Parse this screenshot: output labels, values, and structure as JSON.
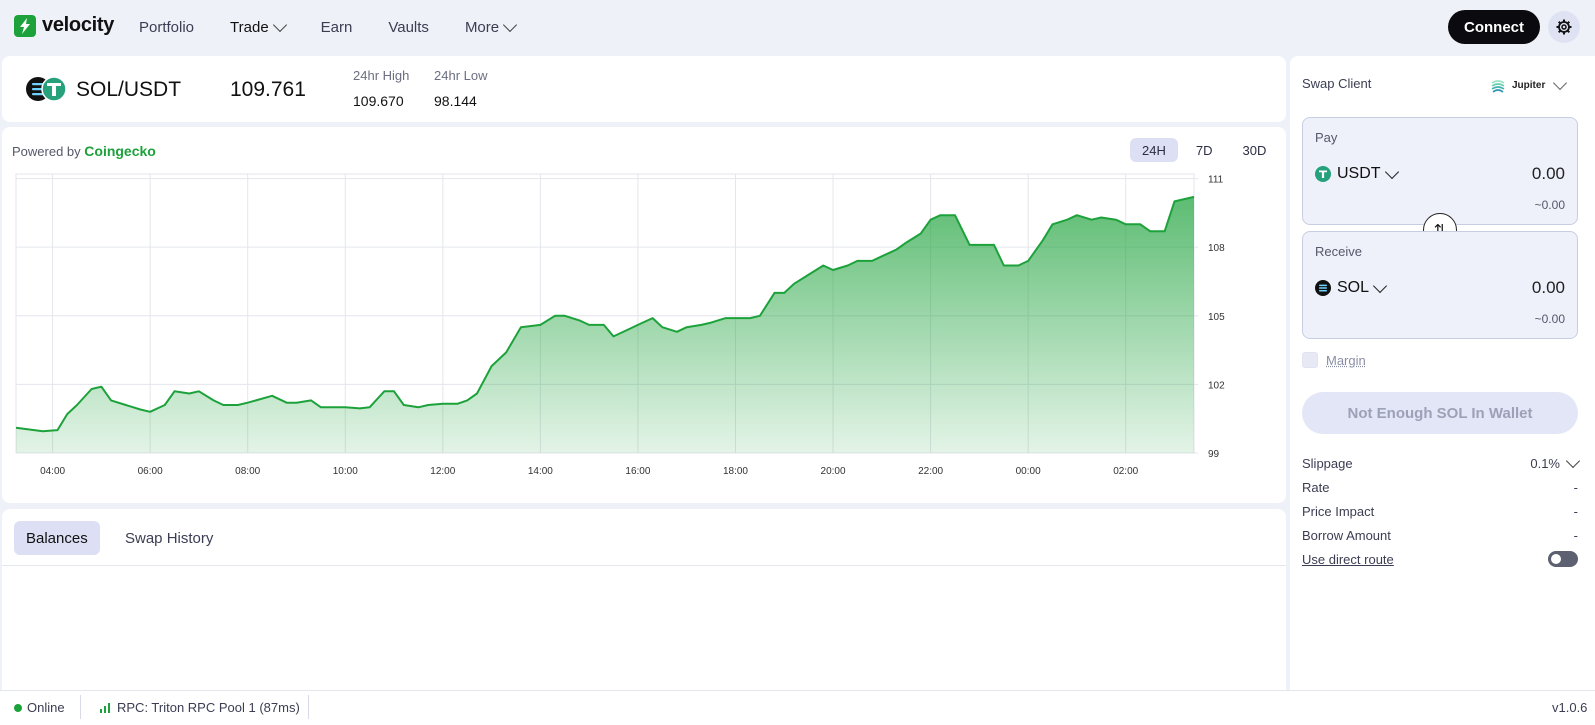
{
  "nav": {
    "brand": "velocity",
    "items": [
      {
        "label": "Portfolio",
        "dropdown": false
      },
      {
        "label": "Trade",
        "dropdown": true
      },
      {
        "label": "Earn",
        "dropdown": false
      },
      {
        "label": "Vaults",
        "dropdown": false
      },
      {
        "label": "More",
        "dropdown": true
      }
    ],
    "connect_label": "Connect"
  },
  "pair": {
    "name": "SOL/USDT",
    "price": "109.761",
    "high_label": "24hr High",
    "high_value": "109.670",
    "low_label": "24hr Low",
    "low_value": "98.144"
  },
  "chart_header": {
    "powered_prefix": "Powered by",
    "powered_brand": "Coingecko",
    "ranges": [
      "24H",
      "7D",
      "30D"
    ],
    "active_range": "24H"
  },
  "chart_data": {
    "type": "area",
    "x_ticks": [
      "04:00",
      "06:00",
      "08:00",
      "10:00",
      "12:00",
      "14:00",
      "16:00",
      "18:00",
      "20:00",
      "22:00",
      "00:00",
      "02:00"
    ],
    "y_ticks": [
      111,
      108,
      105,
      102,
      99
    ],
    "ylim": [
      99,
      111.2
    ],
    "xlim": [
      3.25,
      27.4
    ],
    "grid": true,
    "color": "#1da23b",
    "x": [
      3.25,
      3.8,
      4.1,
      4.3,
      4.5,
      4.8,
      5.0,
      5.2,
      5.5,
      5.8,
      6.0,
      6.3,
      6.5,
      6.8,
      7.0,
      7.3,
      7.5,
      7.8,
      8.0,
      8.5,
      8.8,
      9.0,
      9.3,
      9.5,
      9.8,
      10.0,
      10.3,
      10.5,
      10.8,
      11.0,
      11.2,
      11.5,
      11.7,
      12.0,
      12.3,
      12.5,
      12.7,
      13.0,
      13.3,
      13.6,
      14.0,
      14.3,
      14.5,
      14.8,
      15.0,
      15.3,
      15.5,
      15.8,
      16.0,
      16.3,
      16.5,
      16.8,
      17.0,
      17.3,
      17.5,
      17.8,
      18.0,
      18.3,
      18.5,
      18.8,
      19.0,
      19.2,
      19.5,
      19.8,
      20.0,
      20.3,
      20.5,
      20.8,
      21.0,
      21.3,
      21.5,
      21.8,
      22.0,
      22.2,
      22.5,
      22.8,
      23.0,
      23.3,
      23.5,
      23.8,
      24.0,
      24.3,
      24.5,
      24.8,
      25.0,
      25.3,
      25.5,
      25.8,
      26.0,
      26.3,
      26.5,
      26.8,
      27.0,
      27.4
    ],
    "y": [
      100.1,
      99.95,
      100.0,
      100.7,
      101.1,
      101.8,
      101.9,
      101.3,
      101.1,
      100.9,
      100.8,
      101.1,
      101.7,
      101.6,
      101.7,
      101.3,
      101.1,
      101.1,
      101.2,
      101.5,
      101.2,
      101.2,
      101.3,
      101.0,
      101.0,
      101.0,
      100.95,
      101.0,
      101.7,
      101.7,
      101.1,
      101.0,
      101.1,
      101.15,
      101.15,
      101.3,
      101.6,
      102.8,
      103.4,
      104.5,
      104.6,
      105.0,
      105.0,
      104.8,
      104.6,
      104.6,
      104.1,
      104.4,
      104.6,
      104.9,
      104.5,
      104.3,
      104.5,
      104.6,
      104.7,
      104.9,
      104.9,
      104.9,
      105.0,
      106.0,
      106.0,
      106.4,
      106.8,
      107.2,
      107.0,
      107.2,
      107.4,
      107.4,
      107.6,
      107.9,
      108.2,
      108.6,
      109.2,
      109.4,
      109.4,
      108.1,
      108.1,
      108.1,
      107.2,
      107.2,
      107.4,
      108.3,
      109.0,
      109.2,
      109.4,
      109.2,
      109.3,
      109.2,
      109.0,
      109.0,
      108.7,
      108.7,
      110.0,
      110.2
    ]
  },
  "bottom_tabs": {
    "items": [
      "Balances",
      "Swap History"
    ],
    "active": "Balances"
  },
  "swap": {
    "client_label": "Swap Client",
    "client_value": "Jupiter",
    "pay": {
      "label": "Pay",
      "token": "USDT",
      "amount": "0.00",
      "usd": "~0.00"
    },
    "receive": {
      "label": "Receive",
      "token": "SOL",
      "amount": "0.00",
      "usd": "~0.00"
    },
    "margin_label": "Margin",
    "submit_label": "Not Enough SOL In Wallet",
    "details": [
      {
        "label": "Slippage",
        "value": "0.1%"
      },
      {
        "label": "Rate",
        "value": "-"
      },
      {
        "label": "Price Impact",
        "value": "-"
      },
      {
        "label": "Borrow Amount",
        "value": "-"
      }
    ],
    "direct_route_label": "Use direct route"
  },
  "status": {
    "online": "Online",
    "rpc": "RPC: Triton RPC Pool 1 (87ms)",
    "version": "v1.0.6"
  },
  "colors": {
    "accent": "#1da23b",
    "usdt": "#26a17b",
    "dark": "#0b0b0f"
  }
}
